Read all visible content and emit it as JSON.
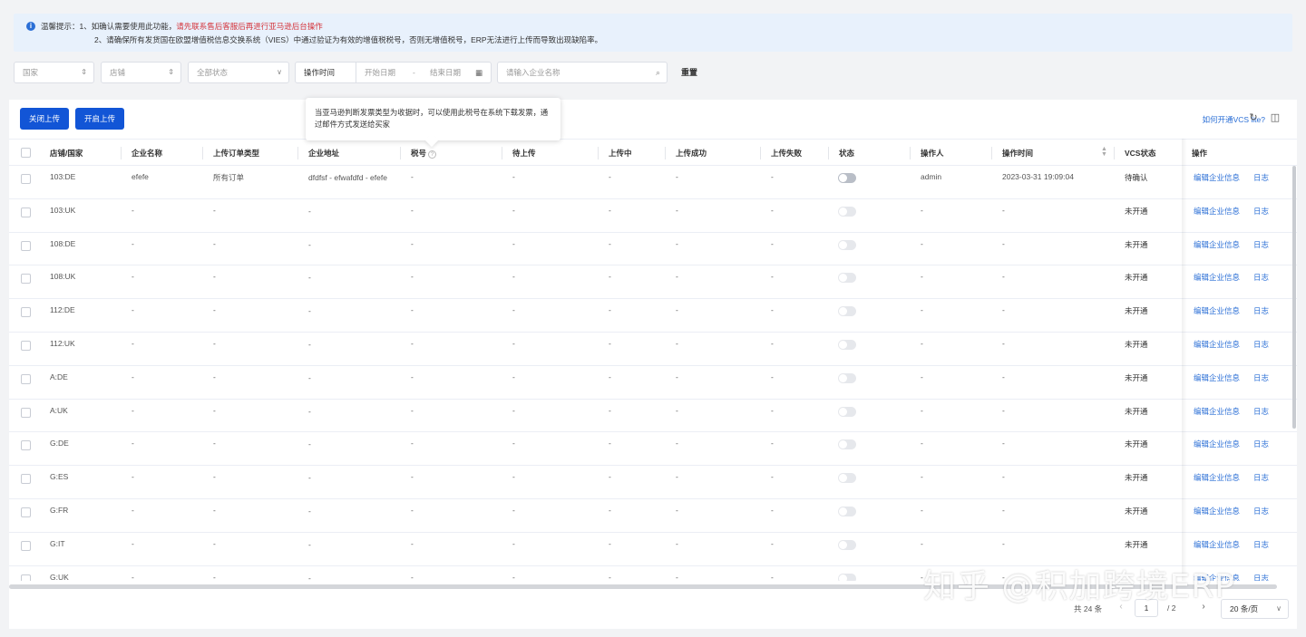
{
  "notice": {
    "prefix": "温馨提示：1、如确认需要使用此功能，",
    "highlight": "请先联系售后客服后再进行亚马逊后台操作",
    "line2": "2、请确保所有发货国在欧盟增值税信息交换系统（VIES）中通过验证为有效的增值税税号，否则无增值税号，ERP无法进行上传而导致出现缺陷率。"
  },
  "filters": {
    "country_placeholder": "国家",
    "store_placeholder": "店铺",
    "status_value": "全部状态",
    "time_type": "操作时间",
    "start_date": "开始日期",
    "date_sep": "-",
    "end_date": "结束日期",
    "search_placeholder": "请输入企业名称",
    "reset": "重置"
  },
  "toolbar": {
    "close_upload": "关闭上传",
    "open_upload": "开启上传",
    "help_link": "如何开通VCS lite?"
  },
  "tooltip": {
    "text": "当亚马逊判断发票类型为收据时，可以使用此税号在系统下载发票，通过邮件方式发送给买家"
  },
  "table": {
    "columns": {
      "store": "店铺/国家",
      "company": "企业名称",
      "order_type": "上传订单类型",
      "address": "企业地址",
      "tax": "税号",
      "pending": "待上传",
      "uploading": "上传中",
      "success": "上传成功",
      "failed": "上传失败",
      "status": "状态",
      "operator": "操作人",
      "op_time": "操作时间",
      "vcs": "VCS状态",
      "action": "操作"
    },
    "action_edit": "编辑企业信息",
    "action_log": "日志",
    "rows": [
      {
        "store": "103:DE",
        "company": "efefe",
        "order_type": "所有订单",
        "address": "dfdfsf - efwafdfd - efefe",
        "tax": "-",
        "pending": "-",
        "uploading": "-",
        "success": "-",
        "failed": "-",
        "status_on": true,
        "operator": "admin",
        "op_time": "2023-03-31 19:09:04",
        "vcs": "待确认"
      },
      {
        "store": "103:UK",
        "company": "-",
        "order_type": "-",
        "address": "-",
        "tax": "-",
        "pending": "-",
        "uploading": "-",
        "success": "-",
        "failed": "-",
        "status_on": false,
        "operator": "-",
        "op_time": "-",
        "vcs": "未开通"
      },
      {
        "store": "108:DE",
        "company": "-",
        "order_type": "-",
        "address": "-",
        "tax": "-",
        "pending": "-",
        "uploading": "-",
        "success": "-",
        "failed": "-",
        "status_on": false,
        "operator": "-",
        "op_time": "-",
        "vcs": "未开通"
      },
      {
        "store": "108:UK",
        "company": "-",
        "order_type": "-",
        "address": "-",
        "tax": "-",
        "pending": "-",
        "uploading": "-",
        "success": "-",
        "failed": "-",
        "status_on": false,
        "operator": "-",
        "op_time": "-",
        "vcs": "未开通"
      },
      {
        "store": "112:DE",
        "company": "-",
        "order_type": "-",
        "address": "-",
        "tax": "-",
        "pending": "-",
        "uploading": "-",
        "success": "-",
        "failed": "-",
        "status_on": false,
        "operator": "-",
        "op_time": "-",
        "vcs": "未开通"
      },
      {
        "store": "112:UK",
        "company": "-",
        "order_type": "-",
        "address": "-",
        "tax": "-",
        "pending": "-",
        "uploading": "-",
        "success": "-",
        "failed": "-",
        "status_on": false,
        "operator": "-",
        "op_time": "-",
        "vcs": "未开通"
      },
      {
        "store": "A:DE",
        "company": "-",
        "order_type": "-",
        "address": "-",
        "tax": "-",
        "pending": "-",
        "uploading": "-",
        "success": "-",
        "failed": "-",
        "status_on": false,
        "operator": "-",
        "op_time": "-",
        "vcs": "未开通"
      },
      {
        "store": "A:UK",
        "company": "-",
        "order_type": "-",
        "address": "-",
        "tax": "-",
        "pending": "-",
        "uploading": "-",
        "success": "-",
        "failed": "-",
        "status_on": false,
        "operator": "-",
        "op_time": "-",
        "vcs": "未开通"
      },
      {
        "store": "G:DE",
        "company": "-",
        "order_type": "-",
        "address": "-",
        "tax": "-",
        "pending": "-",
        "uploading": "-",
        "success": "-",
        "failed": "-",
        "status_on": false,
        "operator": "-",
        "op_time": "-",
        "vcs": "未开通"
      },
      {
        "store": "G:ES",
        "company": "-",
        "order_type": "-",
        "address": "-",
        "tax": "-",
        "pending": "-",
        "uploading": "-",
        "success": "-",
        "failed": "-",
        "status_on": false,
        "operator": "-",
        "op_time": "-",
        "vcs": "未开通"
      },
      {
        "store": "G:FR",
        "company": "-",
        "order_type": "-",
        "address": "-",
        "tax": "-",
        "pending": "-",
        "uploading": "-",
        "success": "-",
        "failed": "-",
        "status_on": false,
        "operator": "-",
        "op_time": "-",
        "vcs": "未开通"
      },
      {
        "store": "G:IT",
        "company": "-",
        "order_type": "-",
        "address": "-",
        "tax": "-",
        "pending": "-",
        "uploading": "-",
        "success": "-",
        "failed": "-",
        "status_on": false,
        "operator": "-",
        "op_time": "-",
        "vcs": "未开通"
      },
      {
        "store": "G:UK",
        "company": "-",
        "order_type": "-",
        "address": "-",
        "tax": "-",
        "pending": "-",
        "uploading": "-",
        "success": "-",
        "failed": "-",
        "status_on": false,
        "operator": "-",
        "op_time": "-",
        "vcs": ""
      }
    ]
  },
  "pagination": {
    "total": "共 24 条",
    "current_page": "1",
    "page_sep": "/",
    "total_pages": "2",
    "page_size": "20 条/页"
  },
  "watermark": "知乎 @积加跨境ERP",
  "colors": {
    "primary": "#1255d6",
    "link": "#2b6fd6",
    "notice_bg": "#e8f1fc",
    "notice_red": "#d4343b"
  }
}
